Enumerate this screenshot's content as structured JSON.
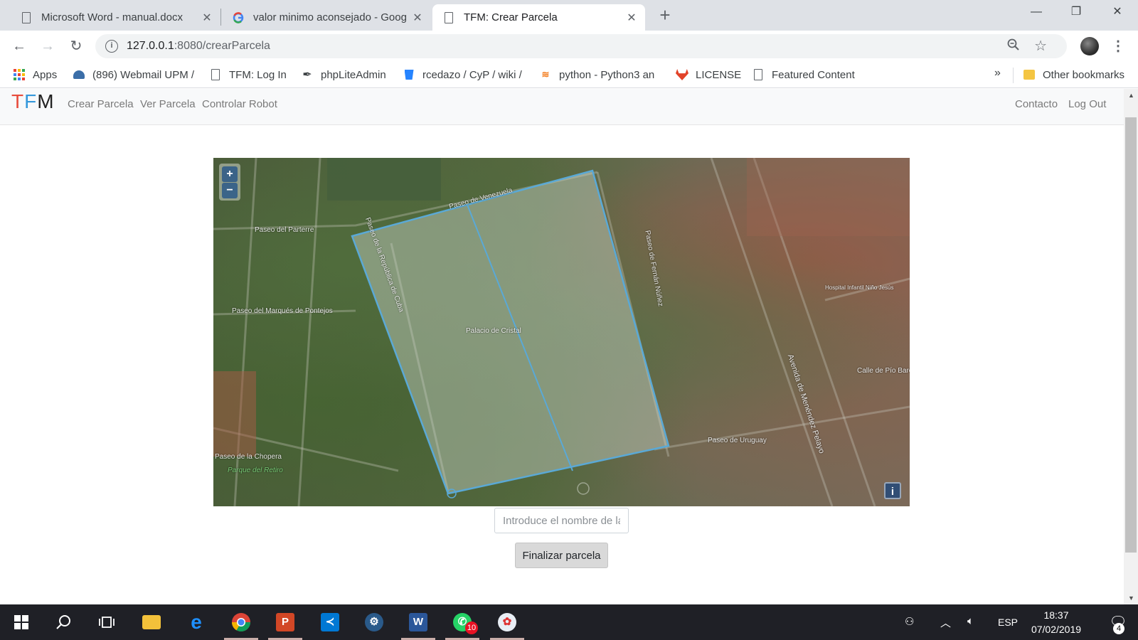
{
  "browser": {
    "tabs": [
      {
        "title": "Microsoft Word - manual.docx",
        "icon": "document-icon"
      },
      {
        "title": "valor minimo aconsejado - Goog",
        "icon": "google-icon"
      },
      {
        "title": "TFM: Crear Parcela",
        "icon": "document-icon",
        "active": true
      }
    ],
    "new_tab": "+",
    "window_controls": {
      "minimize": "—",
      "restore": "❐",
      "close": "✕"
    },
    "url_host": "127.0.0.1",
    "url_path": ":8080/crearParcela",
    "bookmarks": [
      {
        "label": "Apps",
        "icon": "apps-grid-icon"
      },
      {
        "label": "(896) Webmail UPM /",
        "icon": "webmail-icon"
      },
      {
        "label": "TFM: Log In",
        "icon": "document-icon"
      },
      {
        "label": "phpLiteAdmin",
        "icon": "feather-icon"
      },
      {
        "label": "rcedazo / CyP / wiki /",
        "icon": "bitbucket-icon"
      },
      {
        "label": "python - Python3 an",
        "icon": "stackoverflow-icon"
      },
      {
        "label": "LICENSE",
        "icon": "gitlab-icon"
      },
      {
        "label": "Featured Content",
        "icon": "document-icon"
      }
    ],
    "bookmarks_more": "»",
    "other_bookmarks": "Other bookmarks"
  },
  "navbar": {
    "brand": {
      "t": "T",
      "f": "F",
      "m": "M"
    },
    "links": [
      "Crear Parcela",
      "Ver Parcela",
      "Controlar Robot"
    ],
    "right_links": [
      "Contacto",
      "Log Out"
    ]
  },
  "map": {
    "zoom_in": "+",
    "zoom_out": "−",
    "attribution": "i",
    "labels": [
      "Paseo del Parterre",
      "Paseo de Venezuela",
      "Paseo del Marqués de Pontejos",
      "Paseo de la República de Cuba",
      "Palacio de Cristal",
      "Paseo de Fernán Núñez",
      "Avenida de Menéndez Pelayo",
      "Calle de Pío Baroja",
      "Paseo de Uruguay",
      "Paseo de la Chopera",
      "Parque del Retiro",
      "Hospital Infantil Niño Jesús"
    ],
    "polygon_color": "#5aa9d6"
  },
  "form": {
    "name_placeholder": "Introduce el nombre de la parcela",
    "submit_label": "Finalizar parcela"
  },
  "taskbar": {
    "apps": [
      {
        "name": "start-icon"
      },
      {
        "name": "search-icon"
      },
      {
        "name": "task-view-icon"
      },
      {
        "name": "file-explorer-icon"
      },
      {
        "name": "edge-icon"
      },
      {
        "name": "chrome-icon",
        "running": true
      },
      {
        "name": "powerpoint-icon",
        "running": true
      },
      {
        "name": "vscode-icon"
      },
      {
        "name": "steam-icon"
      },
      {
        "name": "word-icon",
        "running": true
      },
      {
        "name": "whatsapp-icon",
        "badge": "10",
        "running": true
      },
      {
        "name": "paint-icon",
        "running": true
      }
    ],
    "language": "ESP",
    "time": "18:37",
    "date": "07/02/2019",
    "notification_count": "4"
  }
}
